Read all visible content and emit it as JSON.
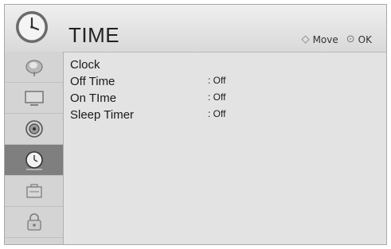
{
  "header": {
    "title": "TIME",
    "move_hint": "Move",
    "ok_hint": "OK",
    "move_glyph": "◇",
    "ok_glyph": "⊙"
  },
  "sidebar": {
    "items": [
      {
        "name": "picture",
        "icon": "satellite-dish-icon",
        "active": false
      },
      {
        "name": "screen",
        "icon": "monitor-icon",
        "active": false
      },
      {
        "name": "audio",
        "icon": "speaker-icon",
        "active": false
      },
      {
        "name": "time",
        "icon": "clock-icon",
        "active": true
      },
      {
        "name": "option",
        "icon": "toolbox-icon",
        "active": false
      },
      {
        "name": "lock",
        "icon": "padlock-icon",
        "active": false
      }
    ]
  },
  "menu": {
    "items": [
      {
        "label": "Clock",
        "value": ""
      },
      {
        "label": "Off Time",
        "value": ": Off"
      },
      {
        "label": "On TIme",
        "value": ": Off"
      },
      {
        "label": "Sleep Timer",
        "value": ": Off"
      }
    ]
  },
  "colors": {
    "active_sidebar": "#7f7f7f",
    "background": "#e3e3e3"
  }
}
